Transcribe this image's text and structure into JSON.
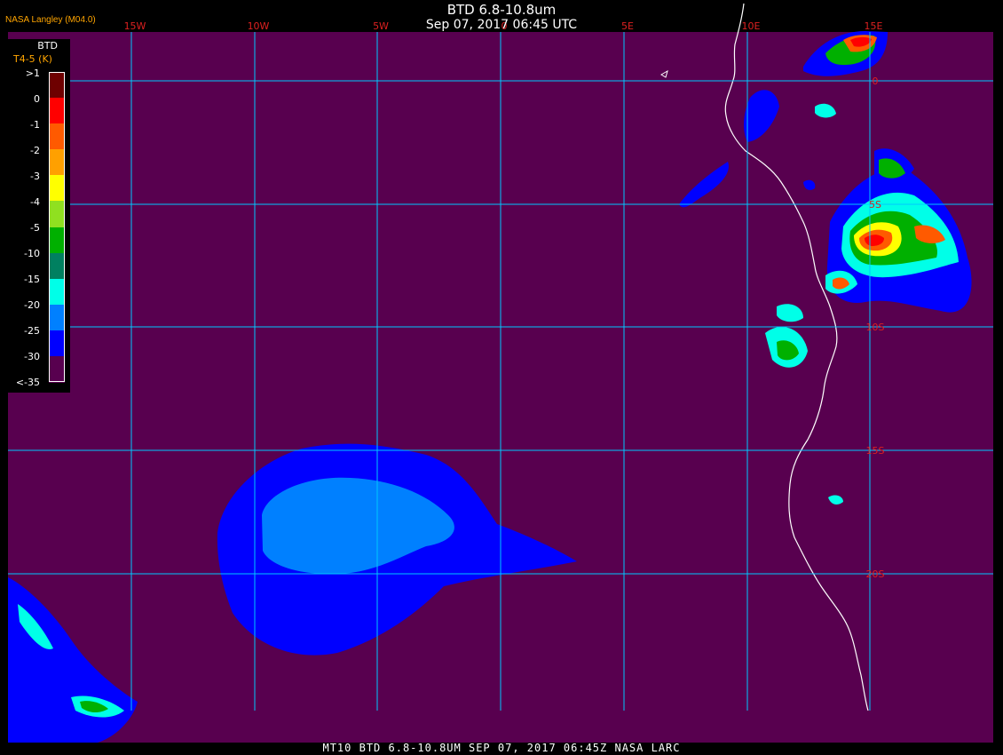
{
  "header": {
    "title": "BTD 6.8-10.8um",
    "subtitle": "Sep 07, 2017 06:45 UTC",
    "source": "NASA Langley (M04.0)"
  },
  "footer": {
    "text": "MT10  BTD 6.8-10.8UM   SEP 07, 2017 06:45Z   NASA LARC"
  },
  "legend": {
    "title": "BTD",
    "subtitle": "T4-5 (K)",
    "labels": [
      ">1",
      "0",
      "-1",
      "-2",
      "-3",
      "-4",
      "-5",
      "-10",
      "-15",
      "-20",
      "-25",
      "-30",
      "<-35"
    ],
    "colors": [
      "#6e0000",
      "#ff0000",
      "#ff5a00",
      "#ffa000",
      "#ffff00",
      "#90e020",
      "#00b000",
      "#008060",
      "#00ffe8",
      "#0080ff",
      "#0000ff",
      "#58004f"
    ]
  },
  "map": {
    "background": "#58004f",
    "grid_color": "#00c8ff",
    "coast_color": "#ffffff",
    "longitude_labels": [
      "15W",
      "10W",
      "5W",
      "0",
      "5E",
      "10E",
      "15E"
    ],
    "latitude_labels": [
      "0",
      "5S",
      "10S",
      "15S",
      "20S"
    ],
    "label_color": "#dd2020"
  }
}
